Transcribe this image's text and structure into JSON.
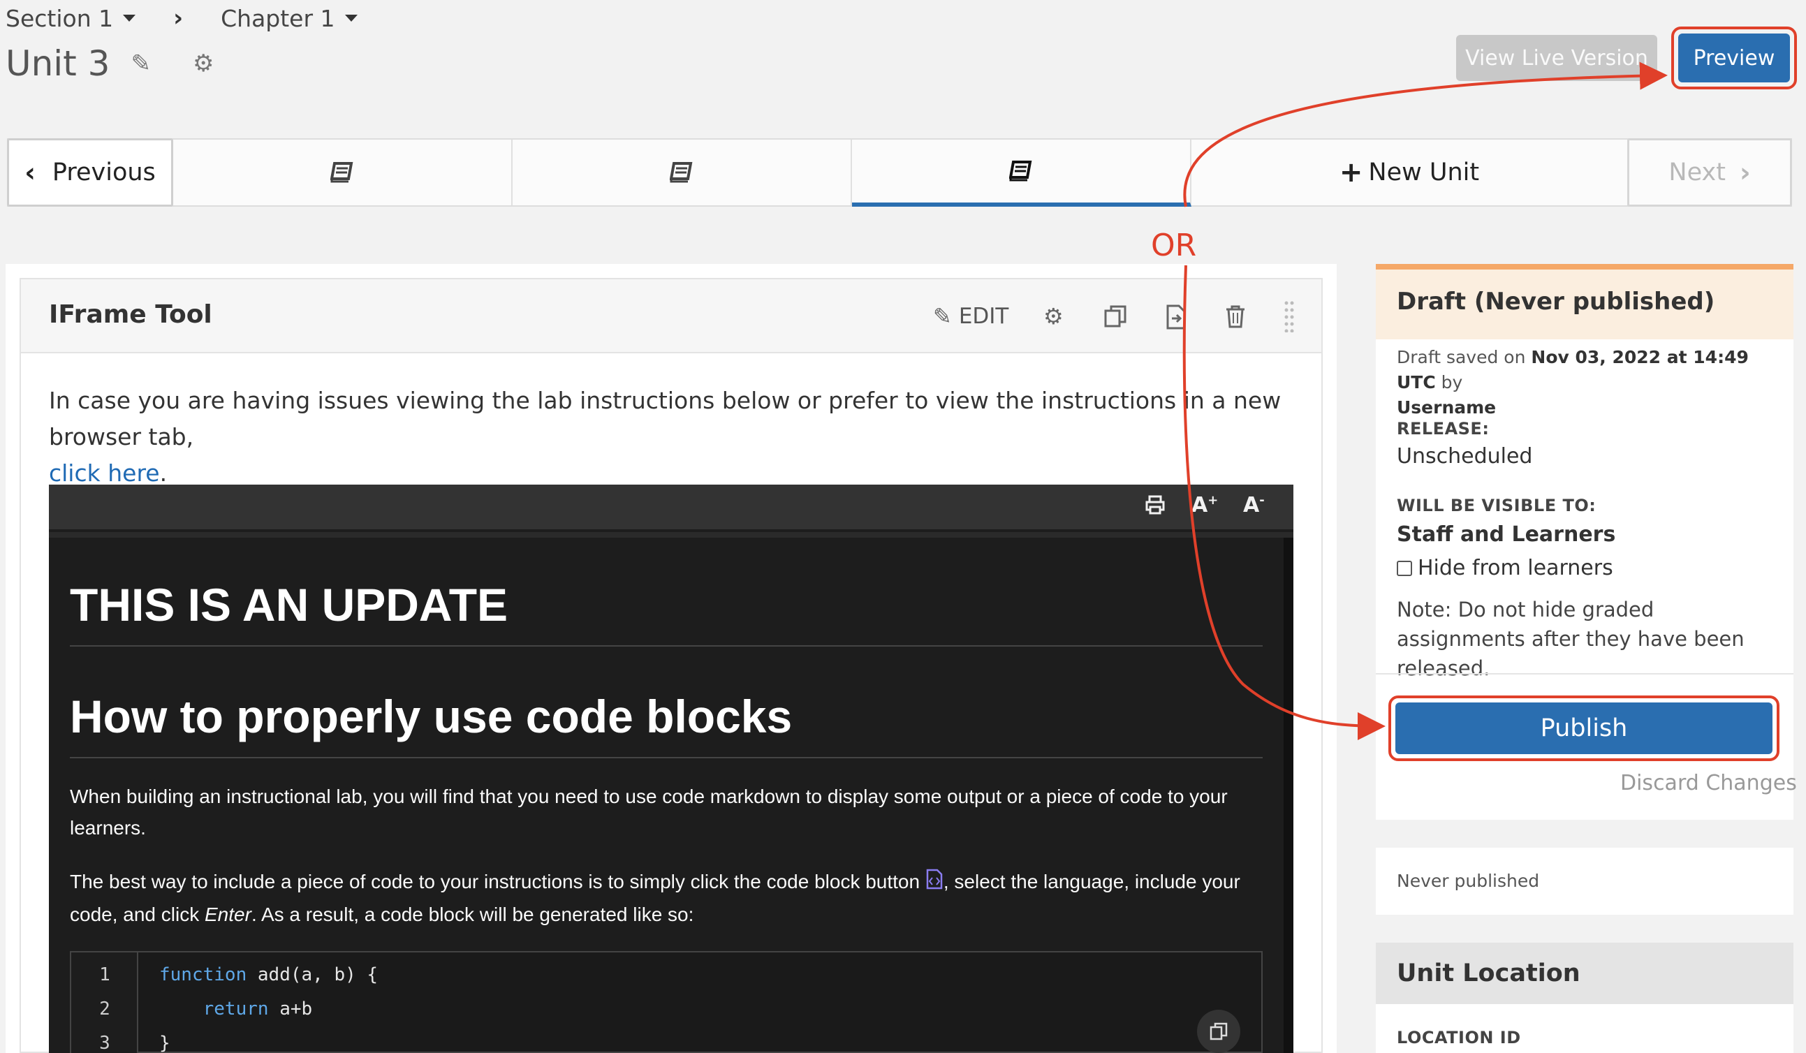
{
  "breadcrumb": {
    "section": "Section 1",
    "chapter": "Chapter 1"
  },
  "unit": {
    "title": "Unit 3"
  },
  "header_buttons": {
    "view_live": "View Live Version",
    "preview": "Preview"
  },
  "unit_nav": {
    "previous": "Previous",
    "new_unit": "New Unit",
    "next": "Next",
    "tabs": [
      {
        "icon": "book-icon",
        "active": false
      },
      {
        "icon": "book-icon",
        "active": false
      },
      {
        "icon": "book-icon",
        "active": true
      }
    ]
  },
  "annotation": {
    "or_label": "OR",
    "color": "#e0402a"
  },
  "component": {
    "title": "IFrame Tool",
    "edit_label": "EDIT",
    "intro_text": "In case you are having issues viewing the lab instructions below or prefer to view the instructions in a new browser tab,",
    "intro_link": "click here",
    "intro_end": "."
  },
  "viewer": {
    "toolbar_font_increase": "A",
    "toolbar_font_decrease": "A",
    "heading1": "THIS IS AN UPDATE",
    "heading2": "How to properly use code blocks",
    "para1": "When building an instructional lab, you will find that you need to use code markdown to display some output or a piece of code to your learners.",
    "para2_a": "The best way to include a piece of code to your instructions is to simply click the code block button",
    "para2_b": ", select the language, include your",
    "para2_c": "code, and click",
    "para2_enter": "Enter",
    "para2_d": ". As a result, a code block will be generated like so:",
    "code": {
      "line_numbers": [
        "1",
        "2",
        "3"
      ],
      "lines": [
        {
          "kw": "function",
          "rest": " add(a, b) {"
        },
        {
          "kw": "    return",
          "rest": " a+b"
        },
        {
          "kw": "",
          "rest": "}"
        }
      ]
    }
  },
  "sidebar": {
    "status_title": "Draft (Never published)",
    "draft_saved_prefix": "Draft saved on",
    "draft_saved_date": "Nov 03, 2022 at 14:49 UTC",
    "draft_saved_by": "by",
    "username": "Username",
    "release_label": "RELEASE:",
    "release_value": "Unscheduled",
    "visible_label": "WILL BE VISIBLE TO:",
    "visible_value": "Staff and Learners",
    "hide_label": "Hide from learners",
    "note": "Note: Do not hide graded assignments after they have been released.",
    "publish": "Publish",
    "discard": "Discard Changes",
    "never_published": "Never published",
    "location_title": "Unit Location",
    "location_id_label": "LOCATION ID"
  },
  "colors": {
    "primary": "#2a6eb0",
    "draft_accent": "#f5a868",
    "link": "#1f6ab4"
  }
}
